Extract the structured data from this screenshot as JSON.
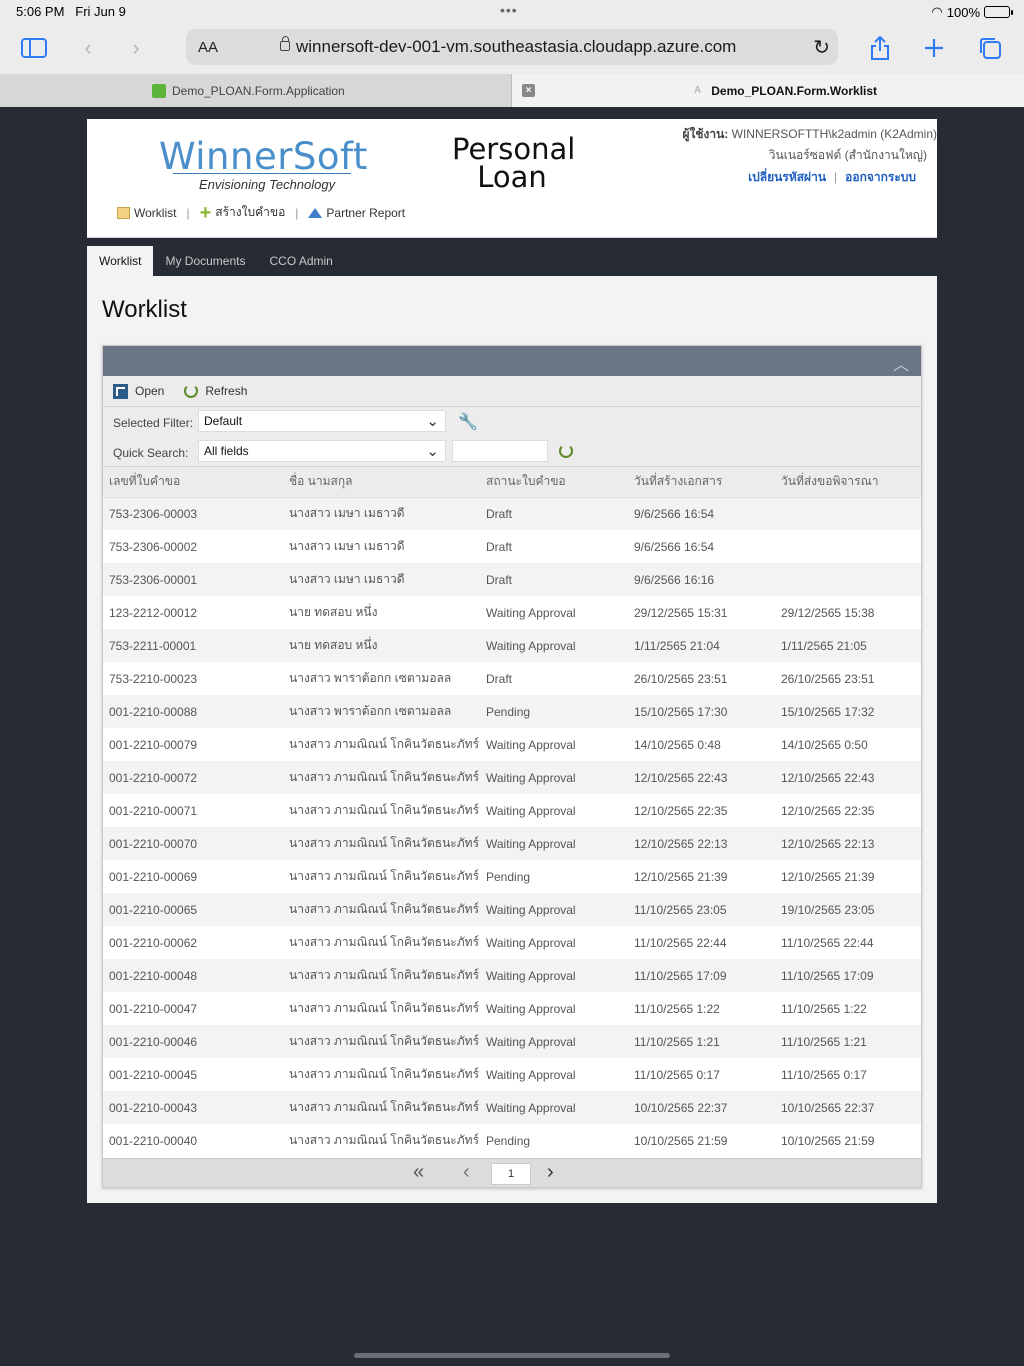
{
  "status": {
    "time": "5:06 PM",
    "date": "Fri Jun 9",
    "battery": "100%"
  },
  "browser": {
    "text_size": "AA",
    "url": "winnersoft-dev-001-vm.southeastasia.cloudapp.azure.com"
  },
  "tabs": [
    {
      "title": "Demo_PLOAN.Form.Application"
    },
    {
      "title": "Demo_PLOAN.Form.Worklist"
    }
  ],
  "header": {
    "logo": "WinnerSoft",
    "tagline": "Envisioning Technology",
    "title_line1": "Personal",
    "title_line2": "Loan",
    "user_label": "ผู้ใช้งาน:",
    "user_name": "WINNERSOFTTH\\k2admin (K2Admin)",
    "branch": "วินเนอร์ซอฟต์ (สำนักงานใหญ่)",
    "change_password": "เปลี่ยนรหัสผ่าน",
    "logout": "ออกจากระบบ",
    "nav": {
      "worklist": "Worklist",
      "create": "สร้างใบคำขอ",
      "report": "Partner Report"
    }
  },
  "main_tabs": [
    "Worklist",
    "My Documents",
    "CCO Admin"
  ],
  "page_title": "Worklist",
  "actions": {
    "open": "Open",
    "refresh": "Refresh"
  },
  "filters": {
    "selected_label": "Selected Filter:",
    "selected_value": "Default",
    "quick_label": "Quick Search:",
    "quick_value": "All fields"
  },
  "columns": [
    "เลขที่ใบคำขอ",
    "ชื่อ นามสกุล",
    "สถานะใบคำขอ",
    "วันที่สร้างเอกสาร",
    "วันที่ส่งขอพิจารณา"
  ],
  "rows": [
    [
      "753-2306-00003",
      "นางสาว เมษา เมธาวดี",
      "Draft",
      "9/6/2566 16:54",
      ""
    ],
    [
      "753-2306-00002",
      "นางสาว เมษา เมธาวดี",
      "Draft",
      "9/6/2566 16:54",
      ""
    ],
    [
      "753-2306-00001",
      "นางสาว เมษา เมธาวดี",
      "Draft",
      "9/6/2566 16:16",
      ""
    ],
    [
      "123-2212-00012",
      "นาย ทดสอบ หนึ่ง",
      "Waiting Approval",
      "29/12/2565 15:31",
      "29/12/2565 15:38"
    ],
    [
      "753-2211-00001",
      "นาย ทดสอบ หนึ่ง",
      "Waiting Approval",
      "1/11/2565 21:04",
      "1/11/2565 21:05"
    ],
    [
      "753-2210-00023",
      "นางสาว พาราต้อกก เซตามอลล",
      "Draft",
      "26/10/2565 23:51",
      "26/10/2565 23:51"
    ],
    [
      "001-2210-00088",
      "นางสาว พาราต้อกก เซตามอลล",
      "Pending",
      "15/10/2565 17:30",
      "15/10/2565 17:32"
    ],
    [
      "001-2210-00079",
      "นางสาว ภามณิณน์ โกคินวัตธนะภัทร์",
      "Waiting Approval",
      "14/10/2565 0:48",
      "14/10/2565 0:50"
    ],
    [
      "001-2210-00072",
      "นางสาว ภามณิณน์ โกคินวัตธนะภัทร์",
      "Waiting Approval",
      "12/10/2565 22:43",
      "12/10/2565 22:43"
    ],
    [
      "001-2210-00071",
      "นางสาว ภามณิณน์ โกคินวัตธนะภัทร์",
      "Waiting Approval",
      "12/10/2565 22:35",
      "12/10/2565 22:35"
    ],
    [
      "001-2210-00070",
      "นางสาว ภามณิณน์ โกคินวัตธนะภัทร์",
      "Waiting Approval",
      "12/10/2565 22:13",
      "12/10/2565 22:13"
    ],
    [
      "001-2210-00069",
      "นางสาว ภามณิณน์ โกคินวัตธนะภัทร์",
      "Pending",
      "12/10/2565 21:39",
      "12/10/2565 21:39"
    ],
    [
      "001-2210-00065",
      "นางสาว ภามณิณน์ โกคินวัตธนะภัทร์",
      "Waiting Approval",
      "11/10/2565 23:05",
      "19/10/2565 23:05"
    ],
    [
      "001-2210-00062",
      "นางสาว ภามณิณน์ โกคินวัตธนะภัทร์",
      "Waiting Approval",
      "11/10/2565 22:44",
      "11/10/2565 22:44"
    ],
    [
      "001-2210-00048",
      "นางสาว ภามณิณน์ โกคินวัตธนะภัทร์",
      "Waiting Approval",
      "11/10/2565 17:09",
      "11/10/2565 17:09"
    ],
    [
      "001-2210-00047",
      "นางสาว ภามณิณน์ โกคินวัตธนะภัทร์",
      "Waiting Approval",
      "11/10/2565 1:22",
      "11/10/2565 1:22"
    ],
    [
      "001-2210-00046",
      "นางสาว ภามณิณน์ โกคินวัตธนะภัทร์",
      "Waiting Approval",
      "11/10/2565 1:21",
      "11/10/2565 1:21"
    ],
    [
      "001-2210-00045",
      "นางสาว ภามณิณน์ โกคินวัตธนะภัทร์",
      "Waiting Approval",
      "11/10/2565 0:17",
      "11/10/2565 0:17"
    ],
    [
      "001-2210-00043",
      "นางสาว ภามณิณน์ โกคินวัตธนะภัทร์",
      "Waiting Approval",
      "10/10/2565 22:37",
      "10/10/2565 22:37"
    ],
    [
      "001-2210-00040",
      "นางสาว ภามณิณน์ โกคินวัตธนะภัทร์",
      "Pending",
      "10/10/2565 21:59",
      "10/10/2565 21:59"
    ]
  ],
  "pager": {
    "page": "1"
  },
  "colors": {
    "accent": "#2f7bf6",
    "panel_header": "#6a7585",
    "logo": "#4a8fcb"
  },
  "icons": [
    "sidebar-icon",
    "back-icon",
    "forward-icon",
    "lock-icon",
    "reload-icon",
    "share-icon",
    "new-tab-icon",
    "tabs-icon",
    "wrench-icon",
    "refresh-icon",
    "open-icon"
  ]
}
